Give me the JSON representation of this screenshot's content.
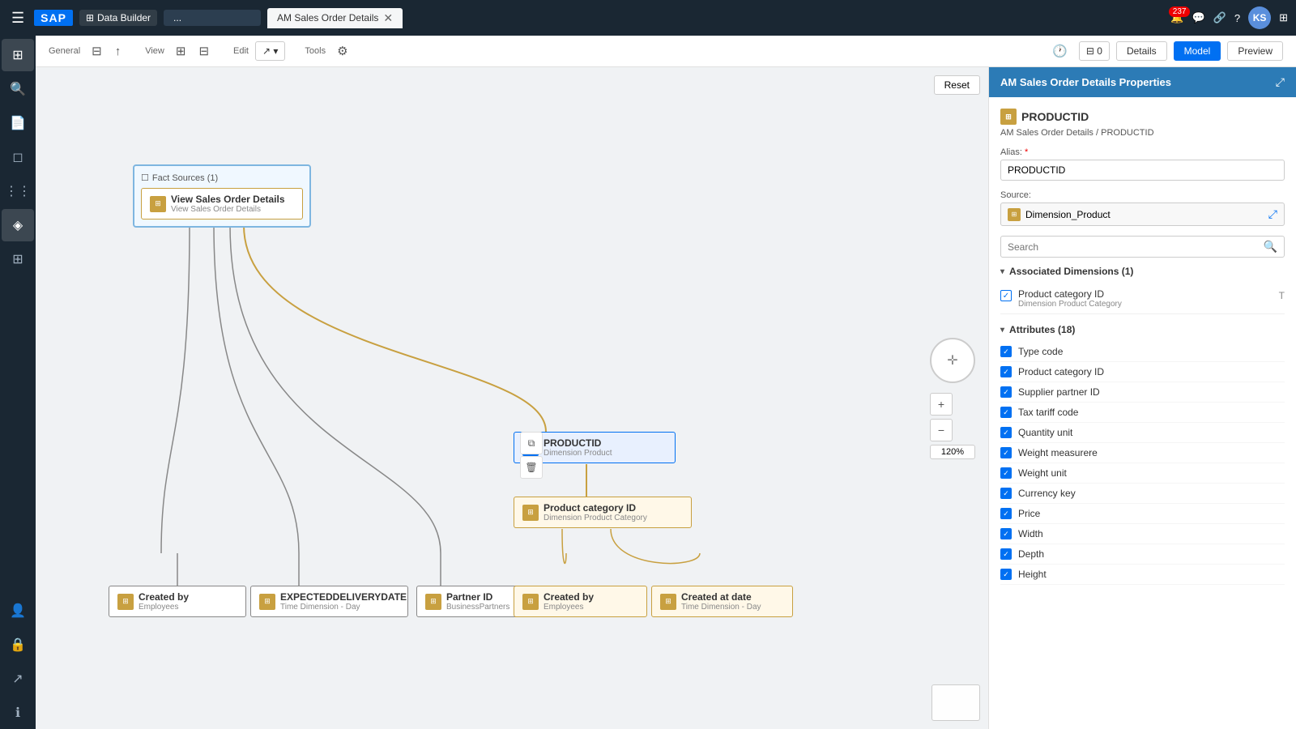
{
  "topbar": {
    "menu_icon": "☰",
    "sap_logo": "SAP",
    "app_icon_label": "Data Builder",
    "tab_inactive": "...",
    "tab_active": "AM Sales Order Details",
    "close_icon": "✕",
    "badge_count": "237",
    "avatar": "KS",
    "icons": [
      "🔔",
      "💬",
      "🔗",
      "?"
    ]
  },
  "sidenav": {
    "items": [
      {
        "icon": "⊞",
        "name": "home"
      },
      {
        "icon": "🔍",
        "name": "search"
      },
      {
        "icon": "📄",
        "name": "documents"
      },
      {
        "icon": "📦",
        "name": "packages"
      },
      {
        "icon": "📊",
        "name": "data"
      },
      {
        "icon": "👥",
        "name": "users"
      },
      {
        "icon": "🔗",
        "name": "connections"
      },
      {
        "icon": "📐",
        "name": "models"
      },
      {
        "icon": "⚙",
        "name": "settings"
      },
      {
        "icon": "👤",
        "name": "profile"
      },
      {
        "icon": "🔒",
        "name": "security"
      },
      {
        "icon": "↗",
        "name": "share"
      },
      {
        "icon": "ℹ",
        "name": "info"
      }
    ]
  },
  "toolbar": {
    "general_label": "General",
    "view_label": "View",
    "edit_label": "Edit",
    "tools_label": "Tools",
    "details_btn": "Details",
    "model_btn": "Model",
    "preview_btn": "Preview",
    "reset_btn": "Reset",
    "zoom": "120%"
  },
  "diagram": {
    "fact_sources_label": "Fact Sources (1)",
    "fact_node_title": "View Sales Order Details",
    "fact_node_sub": "View Sales Order Details",
    "productid_node": {
      "title": "PRODUCTID",
      "sub": "Dimension Product"
    },
    "product_category_node": {
      "title": "Product category ID",
      "sub": "Dimension Product Category"
    },
    "dim_nodes": [
      {
        "title": "Created by",
        "sub": "Employees"
      },
      {
        "title": "EXPECTEDDELIVERYDATE",
        "sub": "Time Dimension - Day"
      },
      {
        "title": "Partner ID",
        "sub": "BusinessPartners"
      },
      {
        "title": "Created by",
        "sub": "Employees"
      },
      {
        "title": "Created at date",
        "sub": "Time Dimension - Day"
      }
    ]
  },
  "panel": {
    "title": "AM Sales Order Details Properties",
    "expand_icon": "⤢",
    "section_title": "PRODUCTID",
    "breadcrumb_link": "AM Sales Order Details",
    "breadcrumb_sep": "/",
    "breadcrumb_end": "PRODUCTID",
    "alias_label": "Alias:",
    "alias_required": "*",
    "alias_value": "PRODUCTID",
    "source_label": "Source:",
    "source_value": "Dimension_Product",
    "search_placeholder": "Search",
    "associated_dims_label": "Associated Dimensions (1)",
    "associated_dims": [
      {
        "name": "Product category ID",
        "sub": "Dimension Product Category",
        "checked": true
      }
    ],
    "attributes_label": "Attributes (18)",
    "attributes": [
      {
        "name": "Type code",
        "checked": true
      },
      {
        "name": "Product category ID",
        "checked": true
      },
      {
        "name": "Supplier partner ID",
        "checked": true
      },
      {
        "name": "Tax tariff code",
        "checked": true
      },
      {
        "name": "Quantity unit",
        "checked": true
      },
      {
        "name": "Weight measurere",
        "checked": true
      },
      {
        "name": "Weight unit",
        "checked": true
      },
      {
        "name": "Currency key",
        "checked": true
      },
      {
        "name": "Price",
        "checked": true
      },
      {
        "name": "Width",
        "checked": true
      },
      {
        "name": "Depth",
        "checked": true
      },
      {
        "name": "Height",
        "checked": true
      }
    ]
  }
}
